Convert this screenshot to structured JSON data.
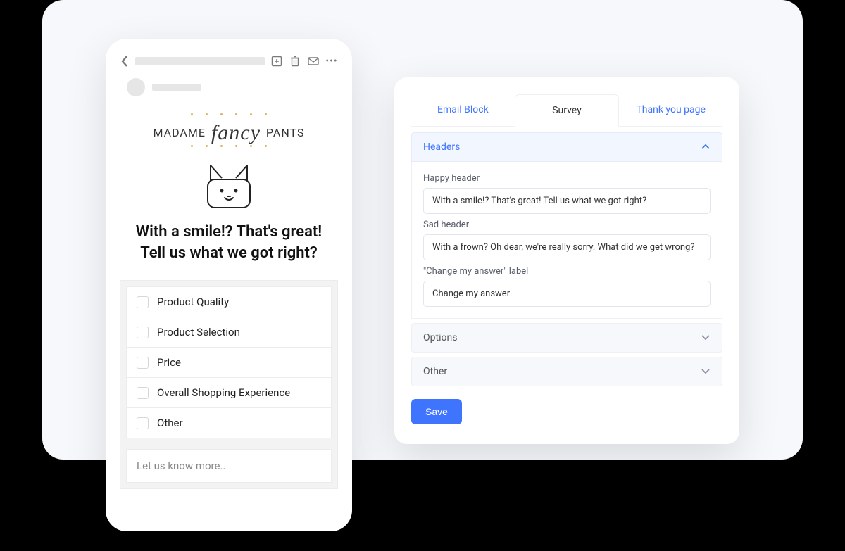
{
  "preview": {
    "brand": {
      "pre": "MADAME",
      "fancy": "fancy",
      "post": "PANTS"
    },
    "heading_line1": "With a smile!? That's great!",
    "heading_line2": "Tell us what we got right?",
    "options": [
      "Product Quality",
      "Product Selection",
      "Price",
      "Overall Shopping Experience",
      "Other"
    ],
    "more_placeholder": "Let us know more.."
  },
  "settings": {
    "tabs": {
      "email_block": "Email Block",
      "survey": "Survey",
      "thank_you": "Thank you page"
    },
    "headers_section": {
      "title": "Headers",
      "happy_label": "Happy header",
      "happy_value": "With a smile!? That's great! Tell us what we got right?",
      "sad_label": "Sad header",
      "sad_value": "With a frown? Oh dear, we're really sorry. What did we get wrong?",
      "change_label": "\"Change my answer\" label",
      "change_value": "Change my answer"
    },
    "options_section": "Options",
    "other_section": "Other",
    "save": "Save"
  }
}
